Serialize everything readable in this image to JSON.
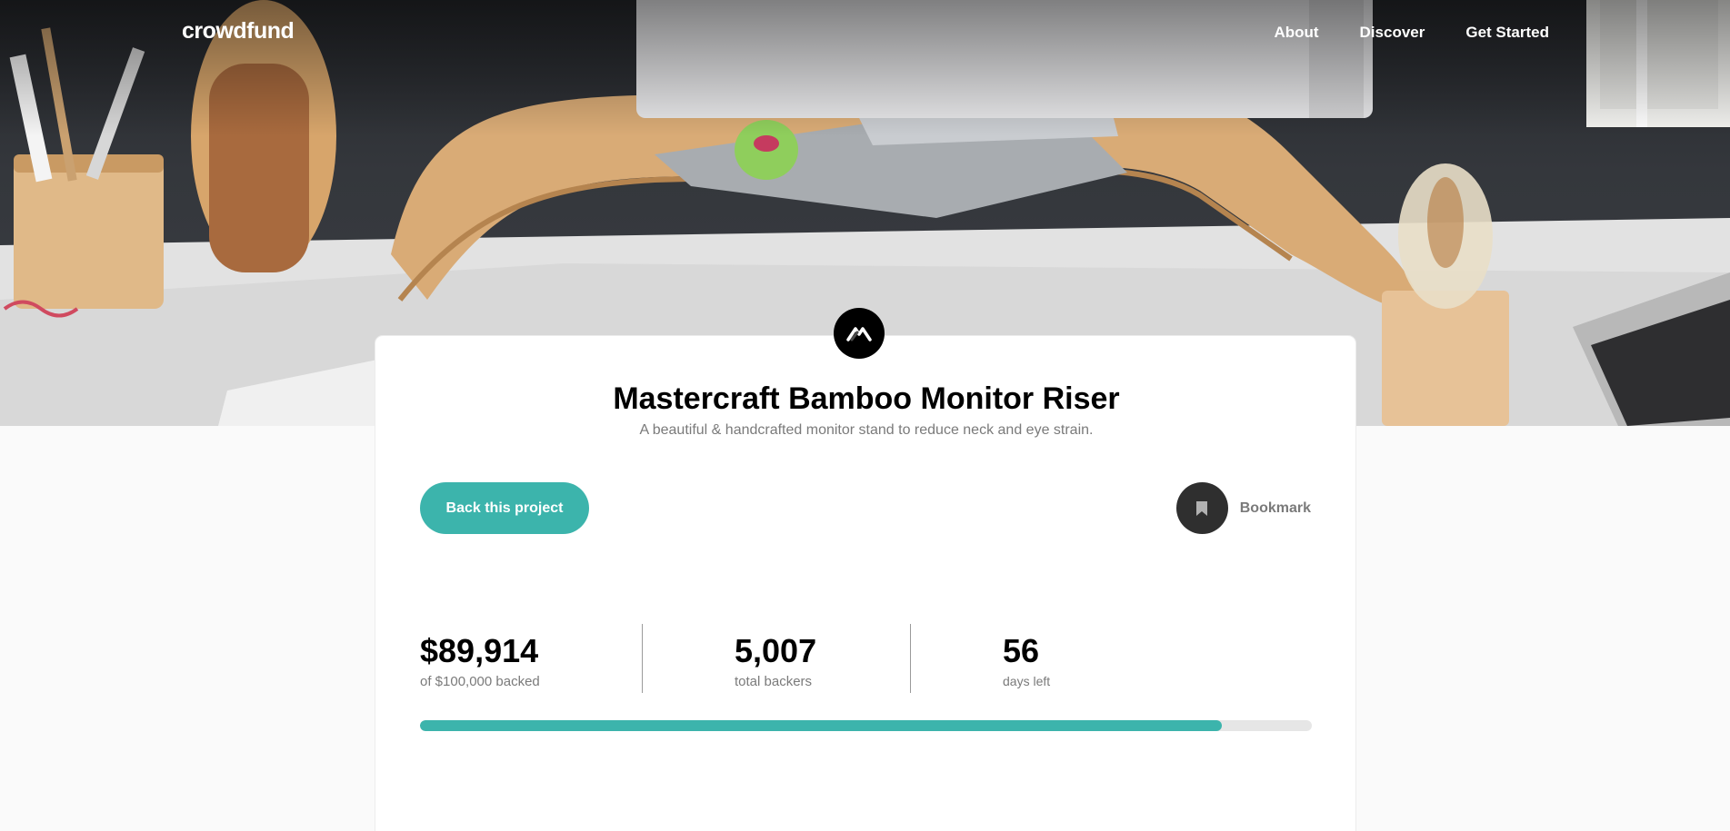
{
  "nav": {
    "logo": "crowdfund",
    "links": [
      "About",
      "Discover",
      "Get Started"
    ]
  },
  "project": {
    "title": "Mastercraft Bamboo Monitor Riser",
    "description": "A beautiful & handcrafted monitor stand to reduce neck and eye strain.",
    "back_button": "Back this project",
    "bookmark_label": "Bookmark"
  },
  "stats": {
    "backed": {
      "value": "$89,914",
      "label": "of $100,000 backed"
    },
    "backers": {
      "value": "5,007",
      "label": "total backers"
    },
    "days": {
      "value": "56",
      "label": "days left"
    }
  },
  "progress": {
    "fraction": 0.8991
  },
  "colors": {
    "accent": "#3cb4ac",
    "dark": "#2f2f2f",
    "muted": "#7a7a7a"
  },
  "icons": {
    "logo": "mastercraft-logo-icon",
    "bookmark": "bookmark-icon"
  }
}
